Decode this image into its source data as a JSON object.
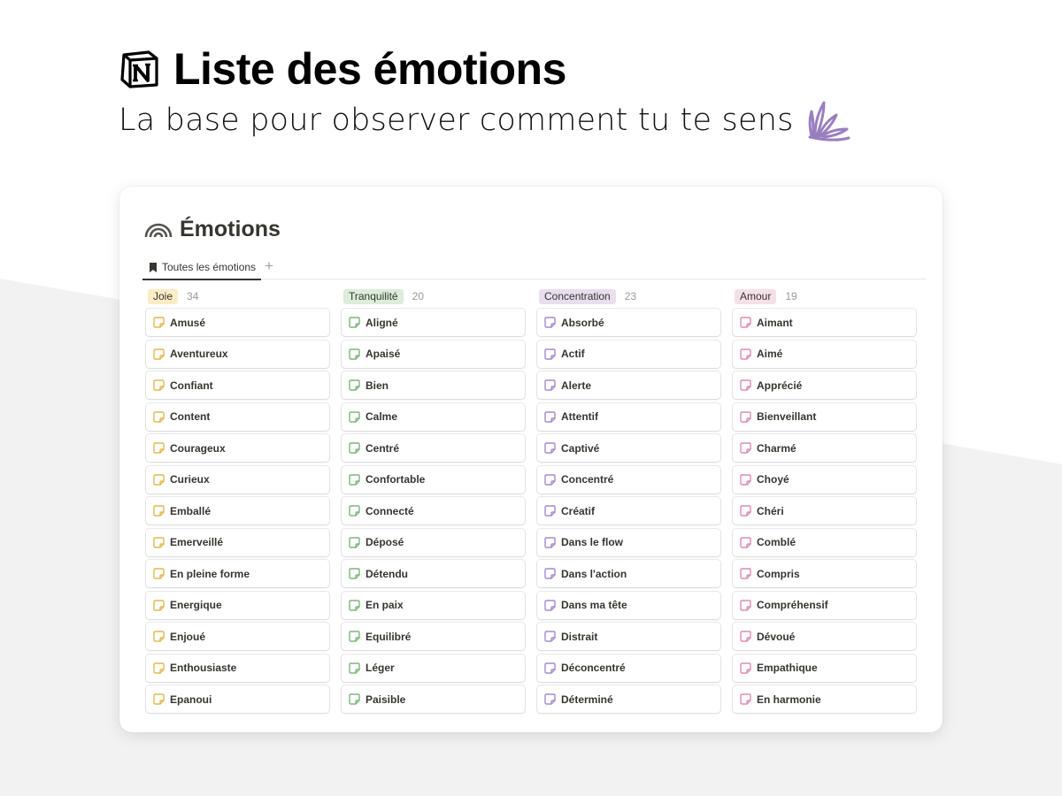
{
  "hero": {
    "title": "Liste des émotions",
    "subtitle": "La base pour observer comment tu te sens"
  },
  "database": {
    "title": "Émotions",
    "view_tab": "Toutes les émotions",
    "add_view": "+"
  },
  "colors": {
    "joie": {
      "badge_bg": "#fbecc6",
      "icon": "#e6b84a"
    },
    "tranquillite": {
      "badge_bg": "#dbeddb",
      "icon": "#7bb77b"
    },
    "concentration": {
      "badge_bg": "#e8deee",
      "icon": "#a58ad1"
    },
    "amour": {
      "badge_bg": "#f5e0e9",
      "icon": "#e08ab3"
    },
    "sparkle": "#9a7fc0"
  },
  "columns": [
    {
      "label": "Joie",
      "count": "34",
      "items": [
        "Amusé",
        "Aventureux",
        "Confiant",
        "Content",
        "Courageux",
        "Curieux",
        "Emballé",
        "Emerveillé",
        "En pleine forme",
        "Energique",
        "Enjoué",
        "Enthousiaste",
        "Epanoui"
      ]
    },
    {
      "label": "Tranquilité",
      "count": "20",
      "items": [
        "Aligné",
        "Apaisé",
        "Bien",
        "Calme",
        "Centré",
        "Confortable",
        "Connecté",
        "Déposé",
        "Détendu",
        "En paix",
        "Equilibré",
        "Léger",
        "Paisible"
      ]
    },
    {
      "label": "Concentration",
      "count": "23",
      "items": [
        "Absorbé",
        "Actif",
        "Alerte",
        "Attentif",
        "Captivé",
        "Concentré",
        "Créatif",
        "Dans le flow",
        "Dans l'action",
        "Dans ma tête",
        "Distrait",
        "Déconcentré",
        "Déterminé"
      ]
    },
    {
      "label": "Amour",
      "count": "19",
      "items": [
        "Aimant",
        "Aimé",
        "Apprécié",
        "Bienveillant",
        "Charmé",
        "Choyé",
        "Chéri",
        "Comblé",
        "Compris",
        "Compréhensif",
        "Dévoué",
        "Empathique",
        "En harmonie"
      ]
    }
  ]
}
